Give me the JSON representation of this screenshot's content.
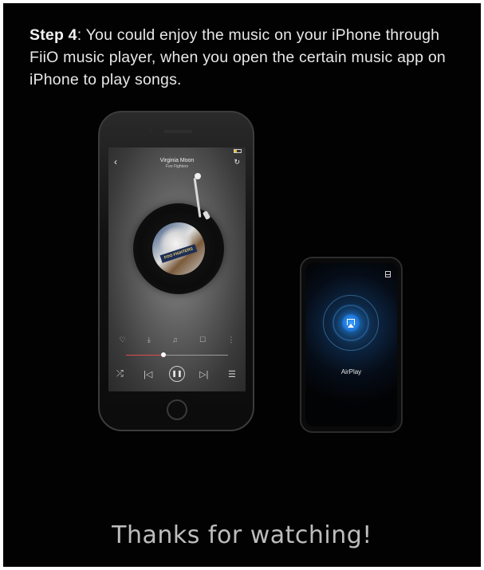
{
  "instructions": {
    "step_label": "Step 4",
    "step_text": ": You could enjoy the music on your iPhone through FiiO music player, when you open the certain music app on iPhone to play songs."
  },
  "iphone": {
    "status_left": "",
    "status_time": "",
    "status_right": "",
    "song_title": "Virginia Moon",
    "song_artist": "Foo Fighters",
    "album_band": "FOO FIGHTERS",
    "time_elapsed": "",
    "time_total": "",
    "progress": 0.37,
    "icons": [
      "back-icon",
      "share-icon",
      "like-icon",
      "download-icon",
      "gift-icon",
      "comment-icon",
      "more-icon",
      "shuffle-icon",
      "prev-icon",
      "pause-icon",
      "next-icon",
      "playlist-icon"
    ]
  },
  "fiio": {
    "airplay_label": "AirPlay",
    "accent_color": "#2a8fff"
  },
  "footer": {
    "thanks": "Thanks for watching!"
  }
}
